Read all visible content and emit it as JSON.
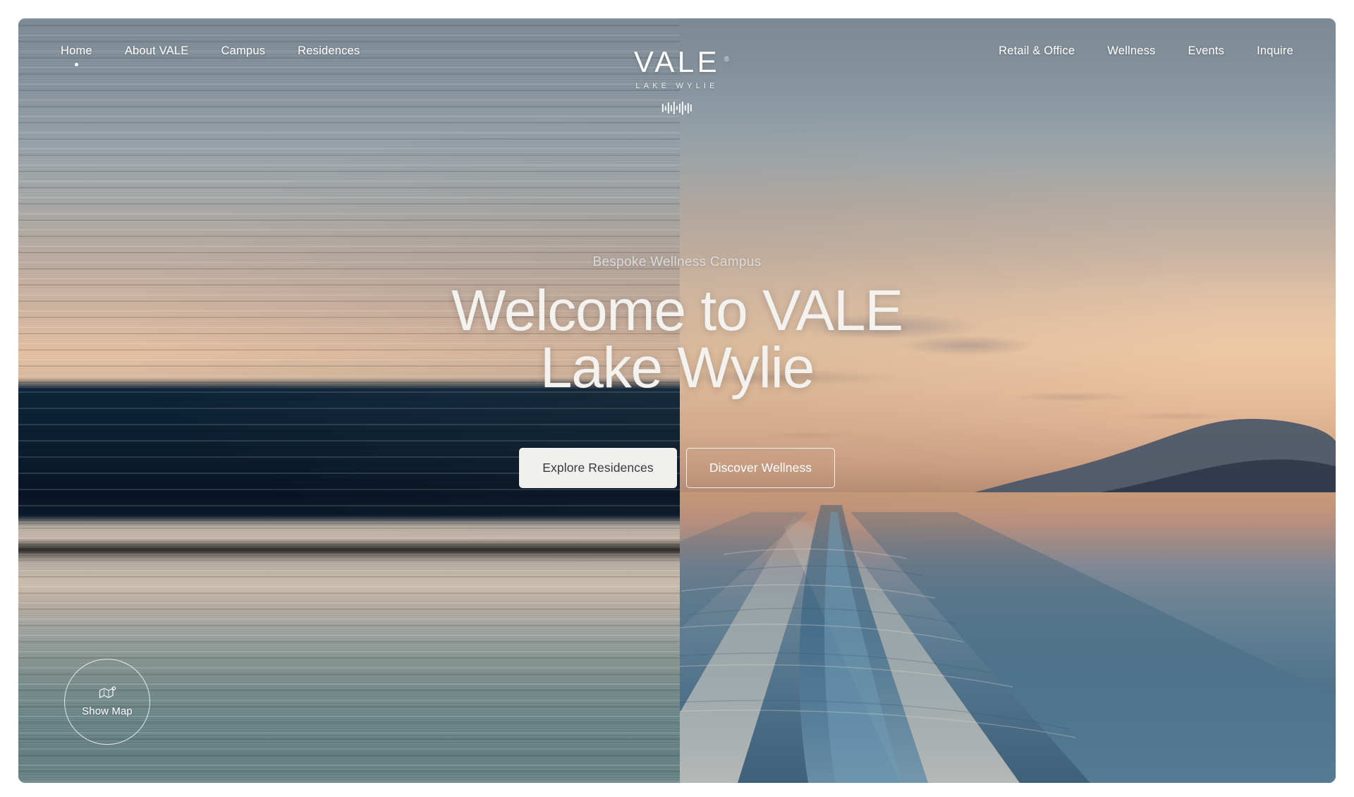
{
  "site": {
    "brand": "VALE",
    "brand_registered_mark": "®",
    "brand_subtitle": "LAKE WYLIE",
    "waveform_icon": "audio-waveform-icon"
  },
  "nav": {
    "left_items": [
      {
        "label": "Home",
        "active": true
      },
      {
        "label": "About VALE",
        "active": false
      },
      {
        "label": "Campus",
        "active": false
      },
      {
        "label": "Residences",
        "active": false
      }
    ],
    "right_items": [
      {
        "label": "Retail & Office"
      },
      {
        "label": "Wellness"
      },
      {
        "label": "Events"
      },
      {
        "label": "Inquire"
      }
    ]
  },
  "hero": {
    "eyebrow": "Bespoke Wellness Campus",
    "headline_line1": "Welcome to VALE",
    "headline_line2": "Lake Wylie",
    "primary_cta": "Explore Residences",
    "secondary_cta": "Discover Wellness"
  },
  "map_button": {
    "label": "Show Map",
    "icon": "map-pin-icon"
  },
  "colors": {
    "page_background": "#ffffff",
    "primary_button_bg": "#f0f0ef",
    "primary_button_text": "#3a3a3a",
    "ghost_button_border": "#ffffff",
    "headline_text": "#f3f2ef",
    "eyebrow_text": "#d9dadb",
    "nav_text": "#ffffff",
    "sky_top": "#8b98a2",
    "sky_sunset": "#edc8a4",
    "water_deep": "#3f6079",
    "dark_band": "#0b2134"
  }
}
